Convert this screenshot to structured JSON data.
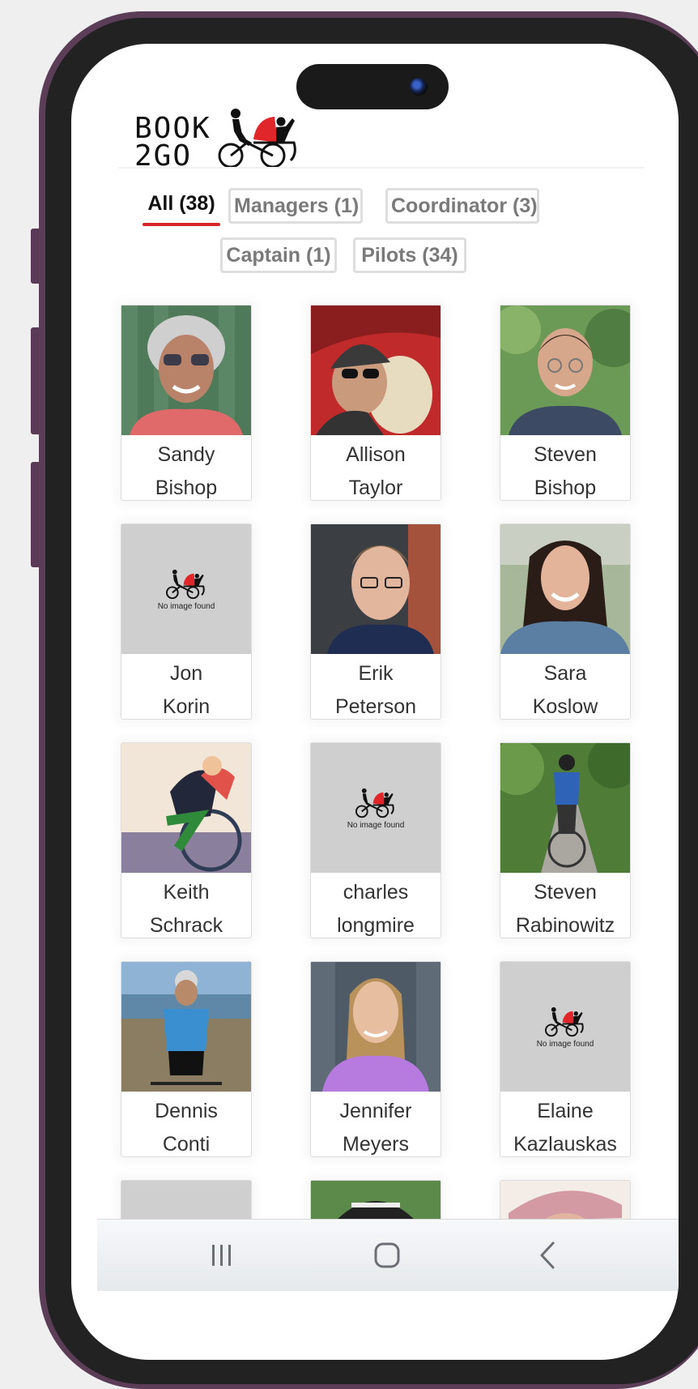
{
  "app": {
    "logo_line1": "BOOK",
    "logo_line2": "2GO"
  },
  "tabs": [
    {
      "label": "All (38)",
      "active": true
    },
    {
      "label": "Managers (1)",
      "active": false
    },
    {
      "label": "Coordinator (3)",
      "active": false
    },
    {
      "label": "Captain (1)",
      "active": false
    },
    {
      "label": "Pilots (34)",
      "active": false
    }
  ],
  "placeholder": {
    "text": "No image found"
  },
  "people": [
    {
      "first": "Sandy",
      "last": "Bishop",
      "has_photo": true
    },
    {
      "first": "Allison",
      "last": "Taylor",
      "has_photo": true
    },
    {
      "first": "Steven",
      "last": "Bishop",
      "has_photo": true
    },
    {
      "first": "Jon",
      "last": "Korin",
      "has_photo": false
    },
    {
      "first": "Erik",
      "last": "Peterson",
      "has_photo": true
    },
    {
      "first": "Sara",
      "last": "Koslow",
      "has_photo": true
    },
    {
      "first": "Keith",
      "last": "Schrack",
      "has_photo": true
    },
    {
      "first": "charles",
      "last": "longmire",
      "has_photo": false
    },
    {
      "first": "Steven",
      "last": "Rabinowitz",
      "has_photo": true
    },
    {
      "first": "Dennis",
      "last": "Conti",
      "has_photo": true
    },
    {
      "first": "Jennifer",
      "last": "Meyers",
      "has_photo": true
    },
    {
      "first": "Elaine",
      "last": "Kazlauskas",
      "has_photo": false
    }
  ],
  "nav": {
    "recent_icon": "recent-apps-icon",
    "home_icon": "home-icon",
    "back_icon": "back-icon"
  },
  "colors": {
    "active_tab_underline": "#d6262b",
    "logo_red": "#e0262b",
    "placeholder_bg": "#cfcfcf",
    "frame": "#5b3d58"
  }
}
